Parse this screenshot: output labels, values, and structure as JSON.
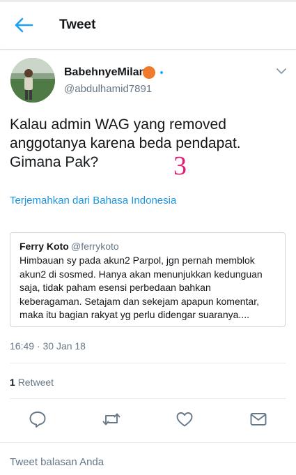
{
  "header": {
    "title": "Tweet",
    "back_icon": "arrow-left-icon",
    "accent": "#1da1f2"
  },
  "author": {
    "display_name": "BabehnyeMilan",
    "handle": "@abdulhamid7891",
    "badge_color": "#f07a2b",
    "menu_icon": "chevron-down-icon"
  },
  "tweet": {
    "text_lines": [
      "Kalau admin WAG yang removed",
      "anggotanya karena beda pendapat.",
      "Gimana Pak?"
    ],
    "overlay_number": "3",
    "overlay_color": "#e21c72",
    "translate_link": "Terjemahkan dari Bahasa Indonesia",
    "timestamp": "16:49 · 30 Jan 18"
  },
  "quoted_tweet": {
    "name": "Ferry Koto",
    "handle": "@ferrykoto",
    "text_lines": [
      "Himbauan sy pada akun2 Parpol, jgn pernah memblok",
      "akun2 di sosmed. Hanya akan menunjukkan kedunguan",
      "saja, tidak paham esensi perbedaan bahkan",
      "keberagaman. Setajam dan sekejam apapun komentar,",
      "maka itu bagian rakyat yg perlu didengar suaranya...."
    ]
  },
  "stats": {
    "retweet_count": "1",
    "retweet_label": "Retweet"
  },
  "actions": [
    "reply-icon",
    "retweet-icon",
    "like-icon",
    "message-icon"
  ],
  "reply": {
    "placeholder": "Tweet balasan Anda"
  }
}
